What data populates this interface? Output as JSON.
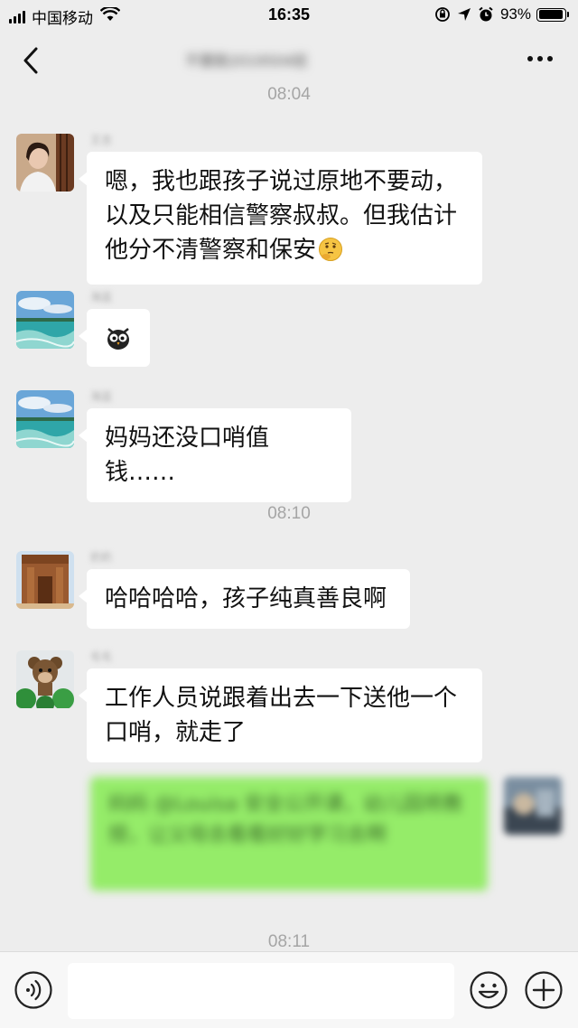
{
  "status_bar": {
    "carrier": "中国移动",
    "time": "16:35",
    "battery_percent": "93%",
    "battery_level": 0.93,
    "icons": [
      "signal-icon",
      "wifi-icon",
      "orientation-lock-icon",
      "location-icon",
      "alarm-icon",
      "battery-icon"
    ]
  },
  "nav": {
    "title": "不要跑2019504班"
  },
  "chat": {
    "timestamps": [
      "08:04",
      "08:10",
      "08:11"
    ],
    "messages": [
      {
        "side": "left",
        "sender": "王吉",
        "avatar": "woman-portrait",
        "text": "嗯，我也跟孩子说过原地不要动，以及只能相信警察叔叔。但我估计他分不清警察和保安",
        "emoji": "thinking-face"
      },
      {
        "side": "left",
        "sender": "海蓝",
        "avatar": "ocean-scenery",
        "text": "",
        "sticker": "owl-emoji"
      },
      {
        "side": "left",
        "sender": "海蓝",
        "avatar": "ocean-scenery",
        "text": "妈妈还没口哨值钱……"
      },
      {
        "side": "left",
        "sender": "奶奶",
        "avatar": "ancient-ruins",
        "text": "哈哈哈哈，孩子纯真善良啊"
      },
      {
        "side": "left",
        "sender": "毛毛",
        "avatar": "toy-monkey",
        "text": "工作人员说跟着出去一下送他一个口哨，就走了"
      },
      {
        "side": "right",
        "avatar": "my-avatar",
        "text": "妈妈 @Louisa 安全公开课，幼儿园将教授，让父母去看看好好学习去啊"
      }
    ]
  },
  "input_bar": {
    "placeholder": "",
    "icons": [
      "voice-icon",
      "emoji-icon",
      "add-icon"
    ]
  },
  "colors": {
    "background": "#ededed",
    "bubble_left": "#ffffff",
    "bubble_right": "#95ec69",
    "timestamp": "#a5a5a5"
  }
}
